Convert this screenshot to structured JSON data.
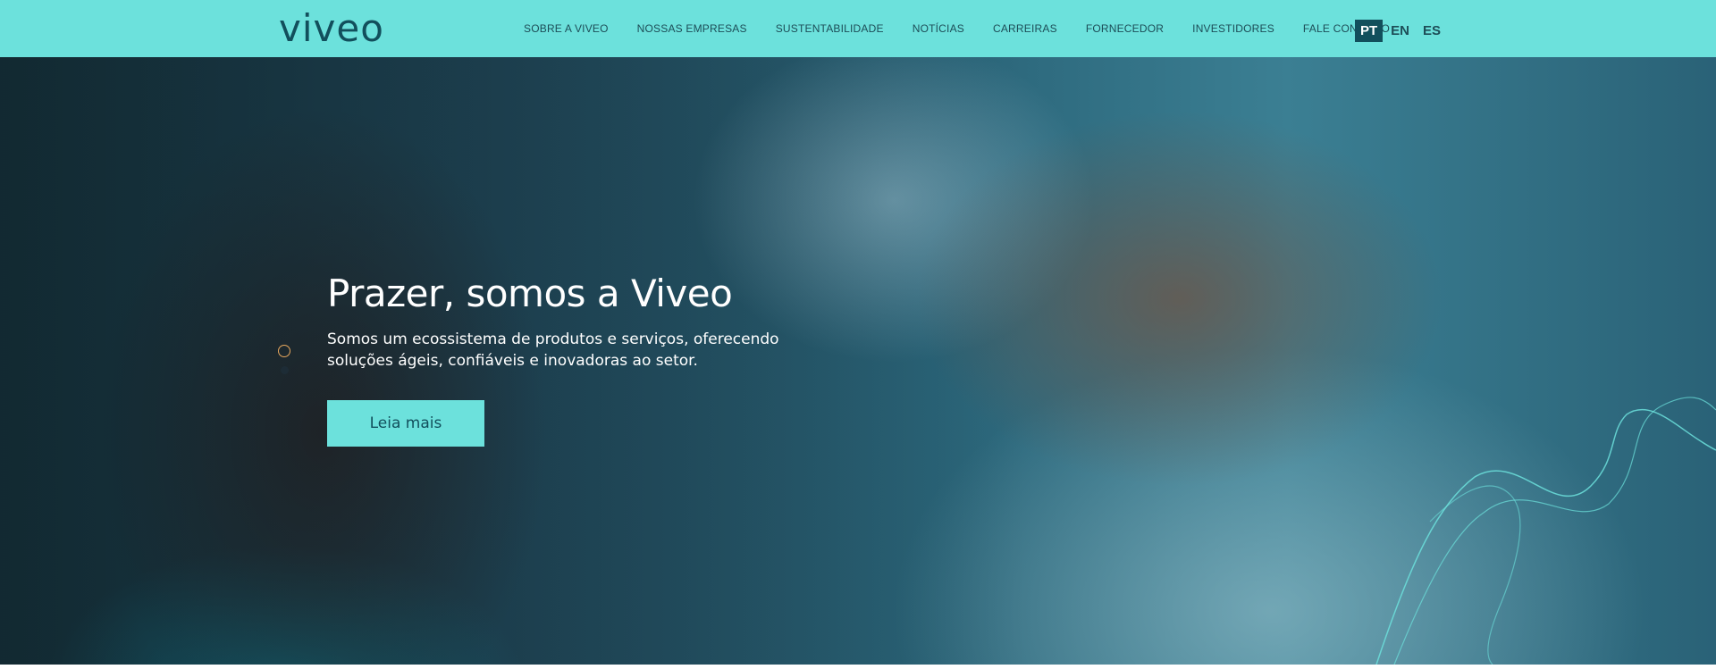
{
  "header": {
    "logo": "viveo",
    "nav": [
      "SOBRE A VIVEO",
      "NOSSAS EMPRESAS",
      "SUSTENTABILIDADE",
      "NOTÍCIAS",
      "CARREIRAS",
      "FORNECEDOR",
      "INVESTIDORES",
      "FALE CONOSCO"
    ],
    "languages": [
      "PT",
      "EN",
      "ES"
    ],
    "active_language": "PT"
  },
  "hero": {
    "title": "Prazer, somos a Viveo",
    "text": "Somos um ecossistema de produtos e serviços, oferecendo soluções ágeis, confiáveis e inovadoras ao setor.",
    "button_label": "Leia mais",
    "slides_total": 2,
    "slide_active": 1
  },
  "colors": {
    "header_bg": "#6ce1dc",
    "brand_dark": "#124f5c",
    "button_bg": "#6ce1dc",
    "active_dot": "#e8a85e",
    "wave_line": "#6ce1dc"
  }
}
